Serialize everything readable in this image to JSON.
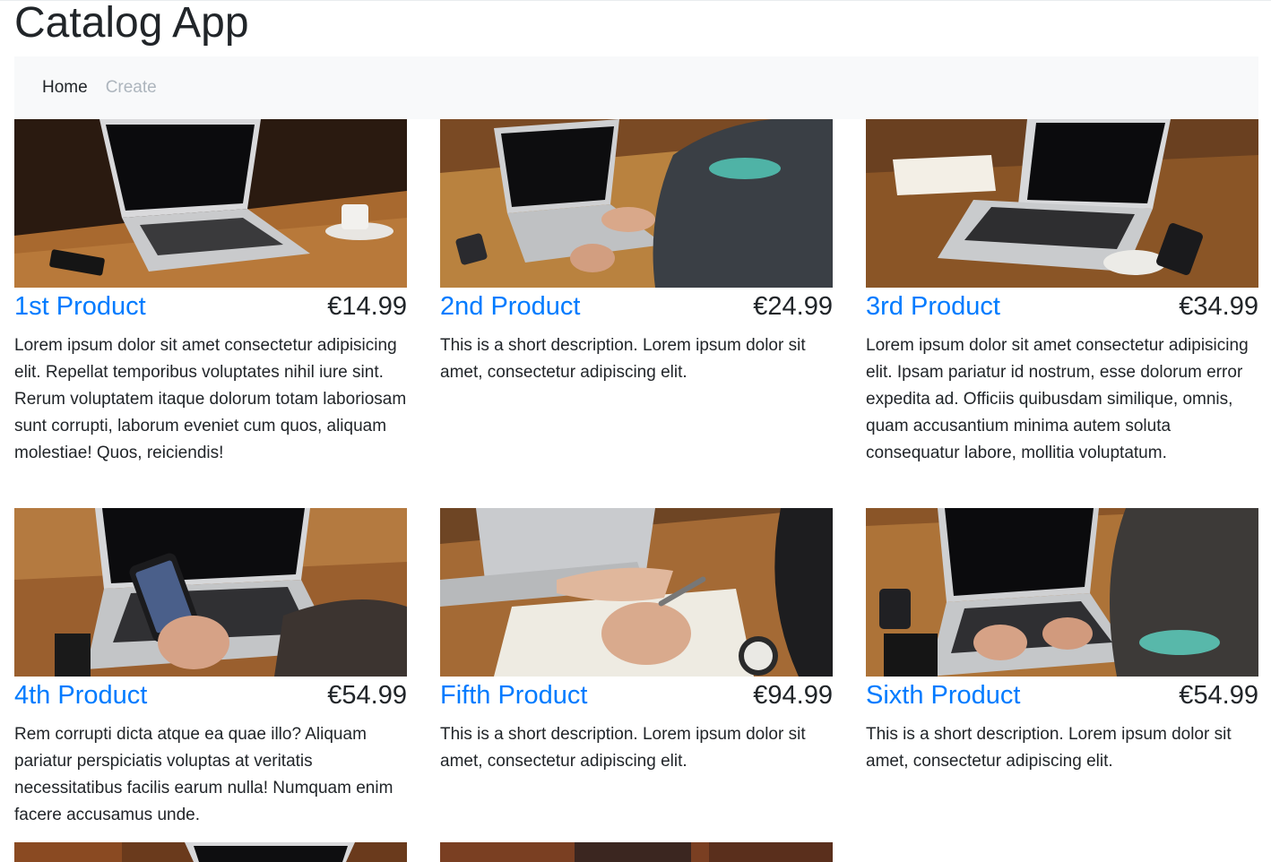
{
  "app": {
    "title": "Catalog App"
  },
  "nav": {
    "home": "Home",
    "create": "Create"
  },
  "products": [
    {
      "name": "1st Product",
      "price": "€14.99",
      "description": "Lorem ipsum dolor sit amet consectetur adipisicing elit. Repellat temporibus voluptates nihil iure sint. Rerum voluptatem itaque dolorum totam laboriosam sunt corrupti, laborum eveniet cum quos, aliquam molestiae! Quos, reiciendis!"
    },
    {
      "name": "2nd Product",
      "price": "€24.99",
      "description": "This is a short description. Lorem ipsum dolor sit amet, consectetur adipiscing elit."
    },
    {
      "name": "3rd Product",
      "price": "€34.99",
      "description": "Lorem ipsum dolor sit amet consectetur adipisicing elit. Ipsam pariatur id nostrum, esse dolorum error expedita ad. Officiis quibusdam similique, omnis, quam accusantium minima autem soluta consequatur labore, mollitia voluptatum."
    },
    {
      "name": "4th Product",
      "price": "€54.99",
      "description": "Rem corrupti dicta atque ea quae illo? Aliquam pariatur perspiciatis voluptas at veritatis necessitatibus facilis earum nulla! Numquam enim facere accusamus unde."
    },
    {
      "name": "Fifth Product",
      "price": "€94.99",
      "description": "This is a short description. Lorem ipsum dolor sit amet, consectetur adipiscing elit."
    },
    {
      "name": "Sixth Product",
      "price": "€54.99",
      "description": "This is a short description. Lorem ipsum dolor sit amet, consectetur adipiscing elit."
    }
  ]
}
